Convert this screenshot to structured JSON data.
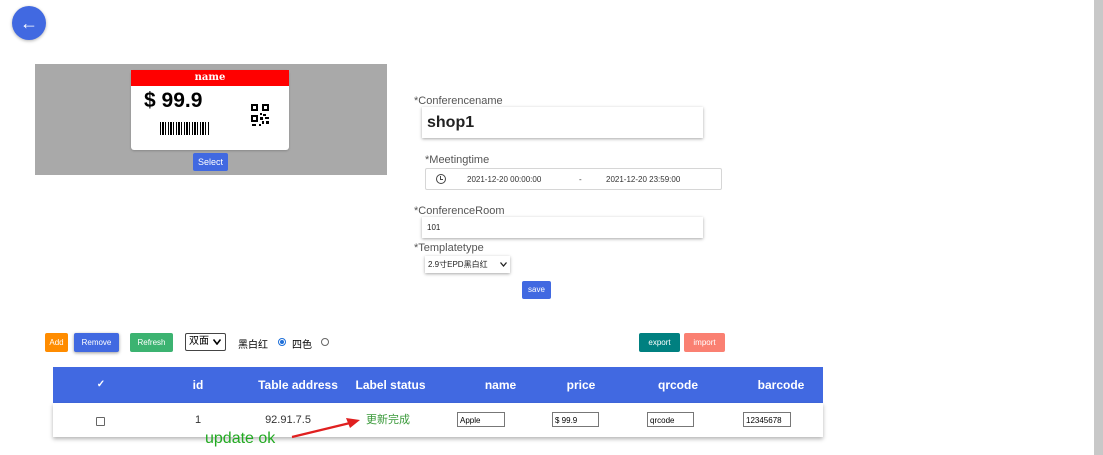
{
  "nav": {
    "back_glyph": "←"
  },
  "preview": {
    "tag_header": "name",
    "tag_price": "$ 99.9",
    "select_label": "Select"
  },
  "form": {
    "conference_name_label": "*Conferencename",
    "conference_name_value": "shop1",
    "meeting_time_label": "*Meetingtime",
    "start_time": "2021-12-20 00:00:00",
    "range_separator": "-",
    "end_time": "2021-12-20 23:59:00",
    "conference_room_label": "*ConferenceRoom",
    "conference_room_value": "101",
    "template_type_label": "*Templatetype",
    "template_type_value": "2.9寸EPD黑白红",
    "save_label": "save"
  },
  "toolbar": {
    "add_label": "Add",
    "remove_label": "Remove",
    "refresh_label": "Refresh",
    "side_select_value": "双面",
    "radio_option_1": "黑白红",
    "radio_option_2": "四色",
    "export_label": "export",
    "import_label": "import"
  },
  "table": {
    "header_check": "✓",
    "headers": [
      "id",
      "Table address",
      "Label status",
      "name",
      "price",
      "qrcode",
      "barcode"
    ],
    "rows": [
      {
        "id": "1",
        "table_address": "92.91.7.5",
        "label_status": "更新完成",
        "name": "Apple",
        "price": "$ 99.9",
        "qrcode": "qrcode",
        "barcode": "12345678"
      }
    ]
  },
  "annotation": {
    "text": "update ok"
  },
  "colors": {
    "primary": "#4169e1",
    "add": "#ff8c00",
    "refresh": "#3cb371",
    "export": "#008080",
    "import": "#fa8072",
    "tag_header": "#ff0000",
    "annotation": "#22aa22",
    "arrow": "#e02020"
  }
}
